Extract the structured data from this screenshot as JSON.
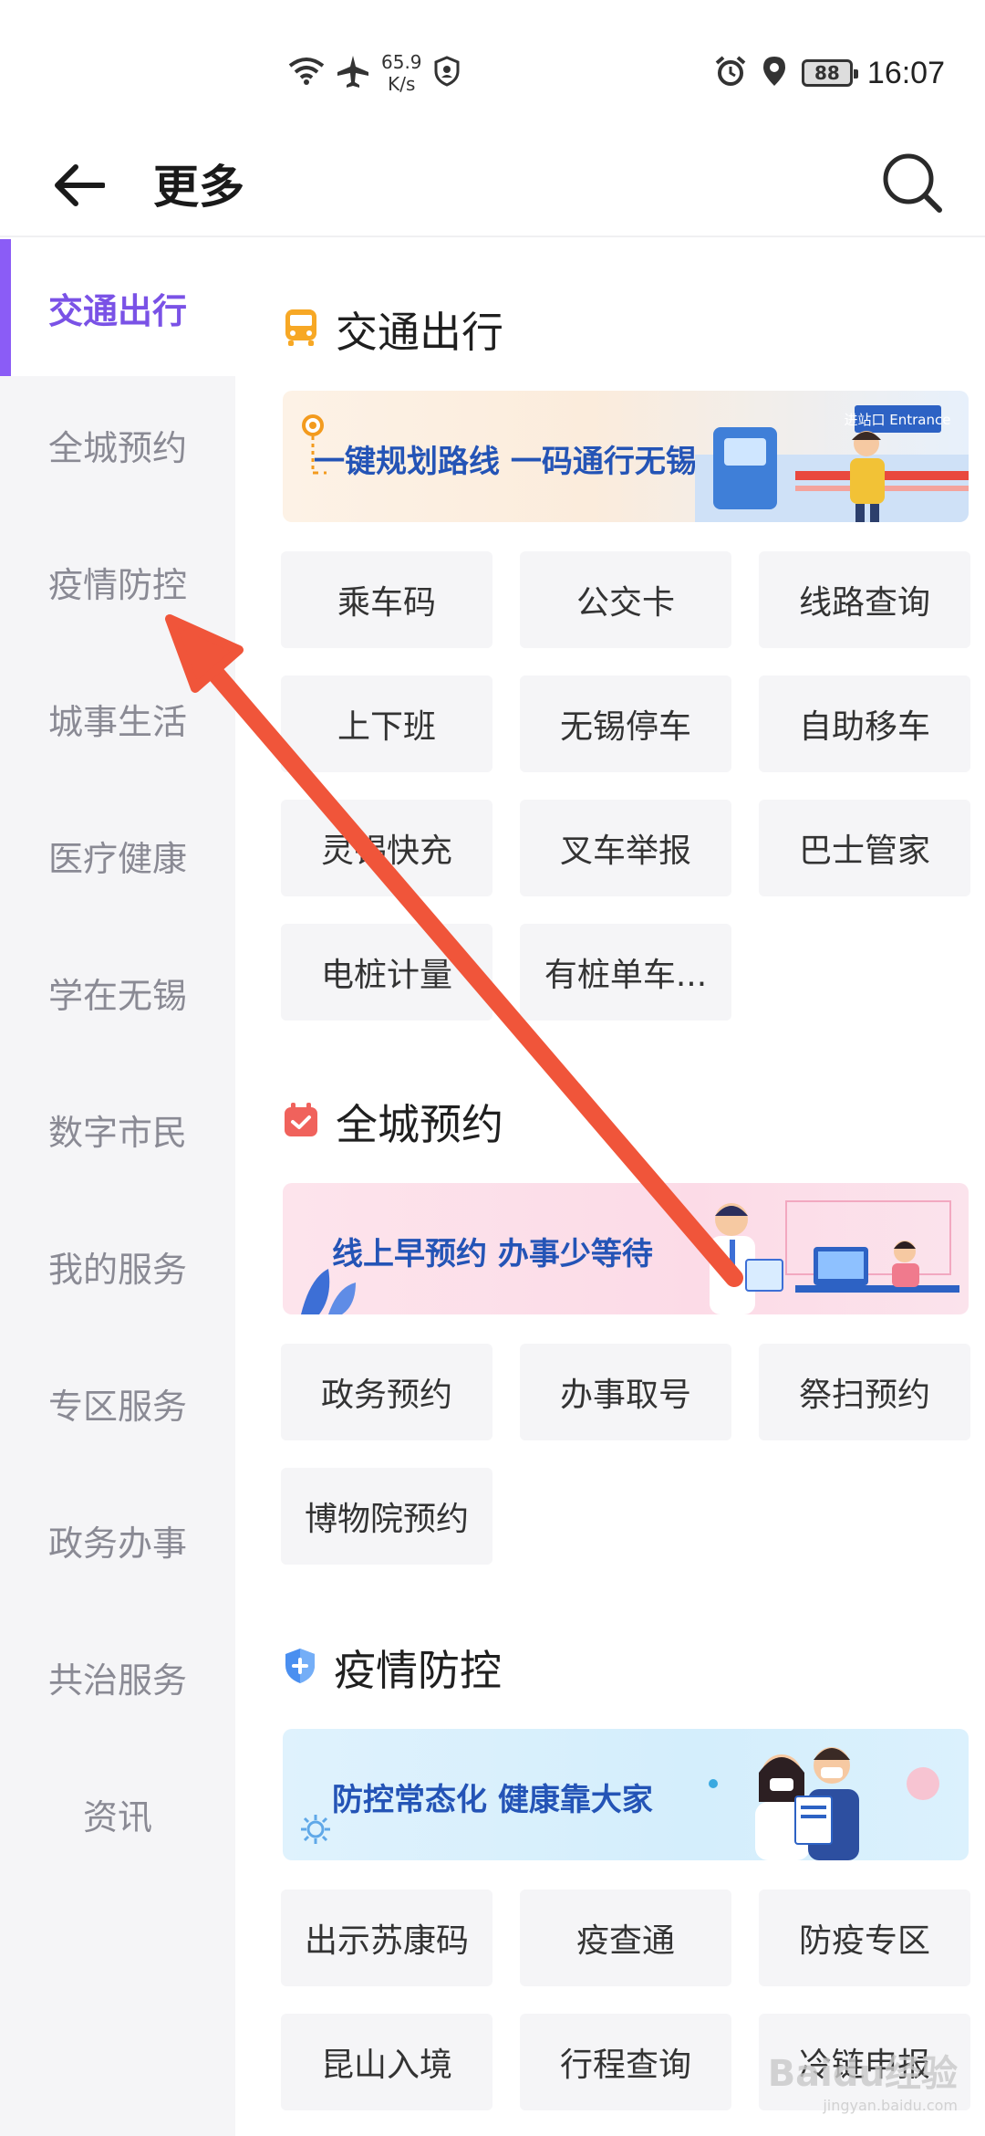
{
  "status_bar": {
    "net_speed_value": "65.9",
    "net_speed_unit": "K/s",
    "battery": "88",
    "time": "16:07"
  },
  "header": {
    "title": "更多"
  },
  "sidebar": {
    "items": [
      {
        "label": "交通出行",
        "active": true
      },
      {
        "label": "全城预约"
      },
      {
        "label": "疫情防控"
      },
      {
        "label": "城事生活"
      },
      {
        "label": "医疗健康"
      },
      {
        "label": "学在无锡"
      },
      {
        "label": "数字市民"
      },
      {
        "label": "我的服务"
      },
      {
        "label": "专区服务"
      },
      {
        "label": "政务办事"
      },
      {
        "label": "共治服务"
      },
      {
        "label": "资讯"
      }
    ]
  },
  "sections": [
    {
      "title": "交通出行",
      "icon": "bus-icon",
      "banner_text": "一键规划路线 一码通行无锡",
      "banner_sign": "进站口 Entrance",
      "tiles": [
        "乘车码",
        "公交卡",
        "线路查询",
        "上下班",
        "无锡停车",
        "自助移车",
        "灵锡快充",
        "叉车举报",
        "巴士管家",
        "电桩计量",
        "有桩单车..."
      ]
    },
    {
      "title": "全城预约",
      "icon": "calendar-icon",
      "banner_text": "线上早预约 办事少等待",
      "tiles": [
        "政务预约",
        "办事取号",
        "祭扫预约",
        "博物院预约"
      ]
    },
    {
      "title": "疫情防控",
      "icon": "shield-plus-icon",
      "banner_text": "防控常态化 健康靠大家",
      "tiles": [
        "出示苏康码",
        "疫查通",
        "防疫专区",
        "昆山入境",
        "行程查询",
        "冷链申报"
      ]
    }
  ],
  "colors": {
    "accent": "#8b5cf6",
    "active_text": "#7a52e6",
    "annotation_arrow": "#f0553a"
  },
  "watermark": {
    "brand": "Baidu经验",
    "url": "jingyan.baidu.com"
  }
}
